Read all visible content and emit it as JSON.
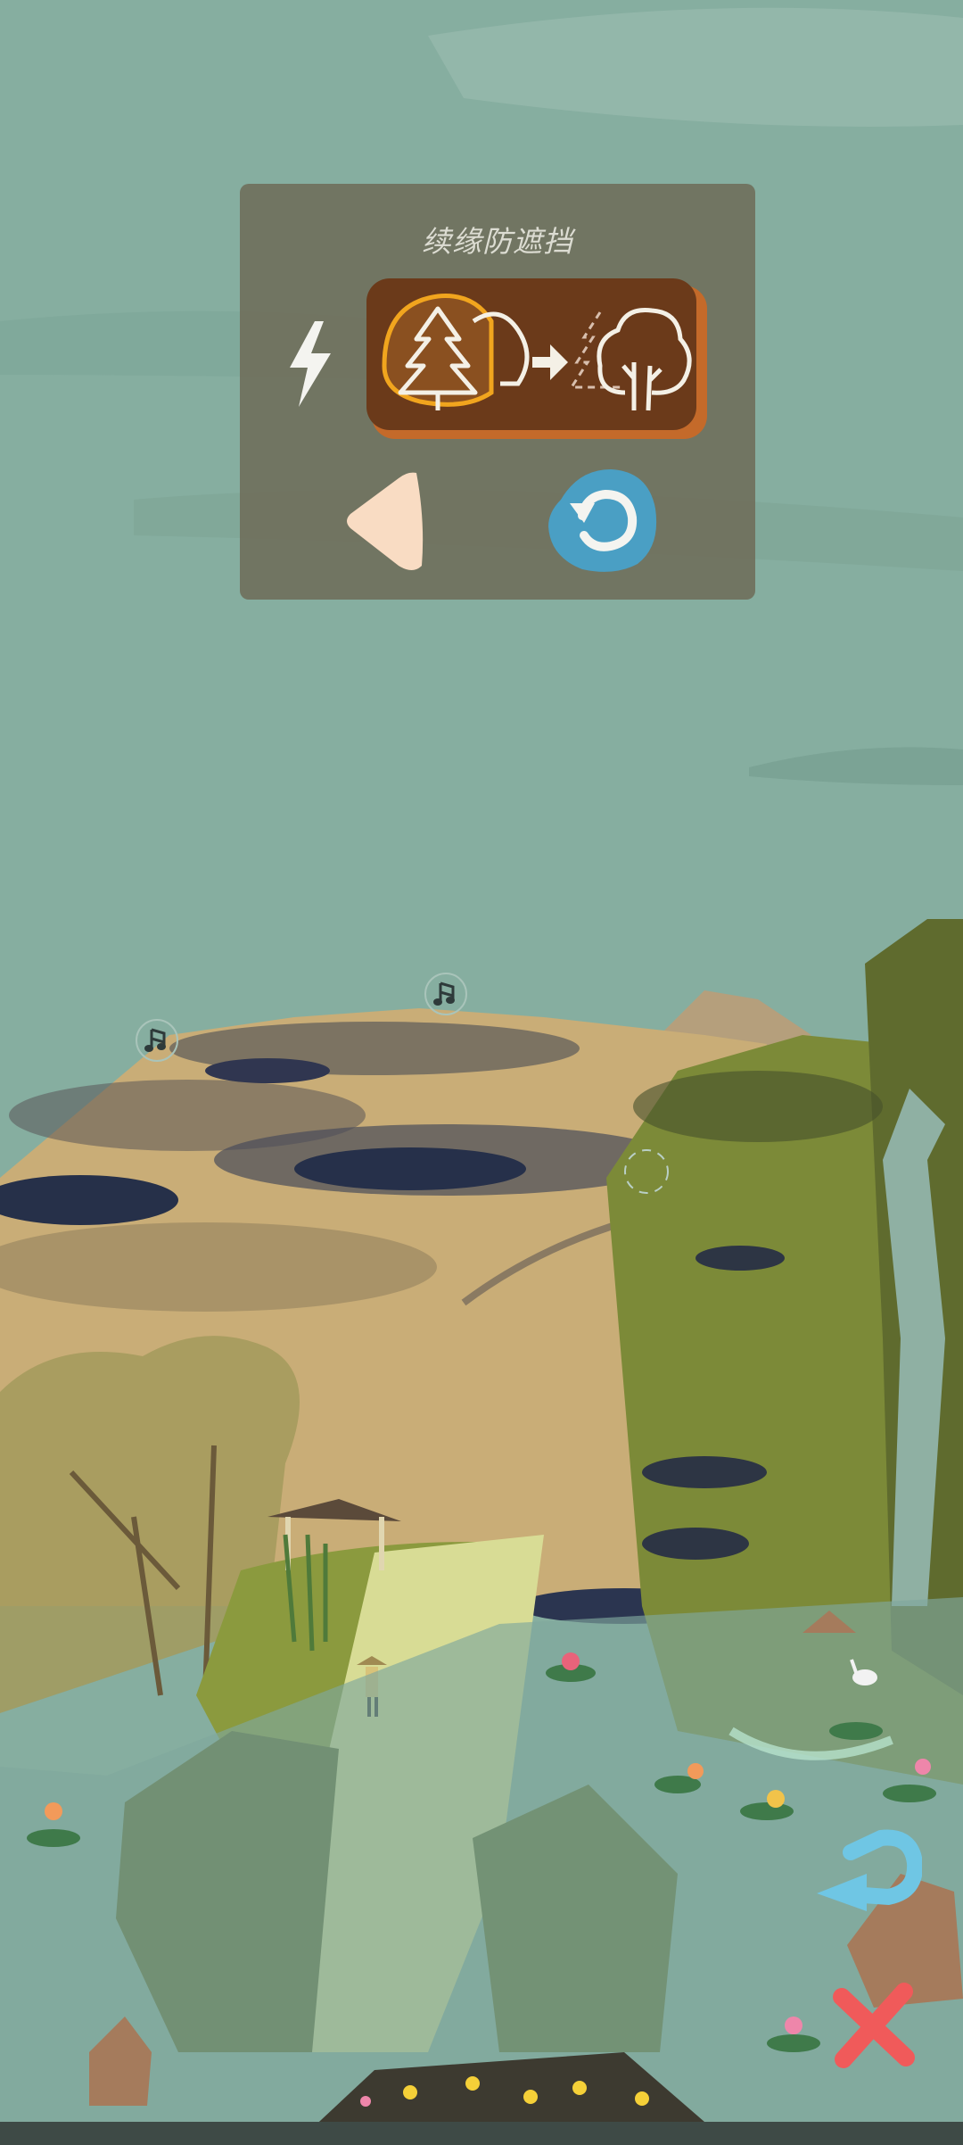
{
  "panel": {
    "title": "续缘防遮挡",
    "skill_icon": "lightning-bolt-icon",
    "card_icon": "tree-transparency-toggle-icon",
    "left_button_icon": "triangle-left-icon",
    "reset_button_icon": "reset-circular-arrow-icon"
  },
  "hud": {
    "undo_icon": "return-arrow-icon",
    "close_icon": "close-x-icon",
    "music_icons": [
      "music-note-icon",
      "music-note-icon"
    ]
  },
  "colors": {
    "sky": "#86aea0",
    "panel_bg": "#70705c",
    "card_bg": "#6b3a1a",
    "card_shadow": "#c46a2a",
    "accent_reset": "#4a9fc4",
    "triangle": "#f9dcc3",
    "close_x": "#f05a5a",
    "undo_arrow": "#6fc6e4"
  }
}
